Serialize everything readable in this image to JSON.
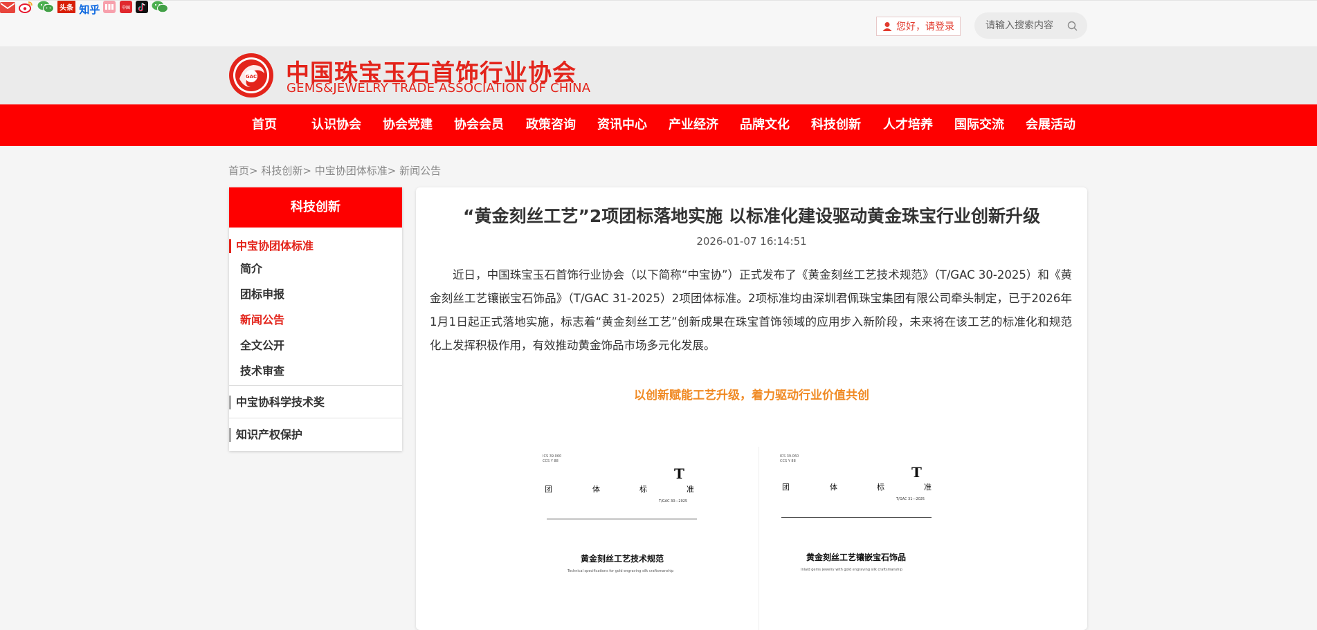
{
  "topbar": {
    "icons": [
      "mail-icon",
      "weibo-icon",
      "wechat-icon",
      "toutiao-icon",
      "zhihu-icon",
      "xiaohongshu-icon",
      "china-icon",
      "douyin-icon",
      "wechat-channel-icon"
    ],
    "toutiao_label": "头条",
    "zhihu_label": "知乎",
    "china_label": "中国",
    "login_text": "您好，请登录",
    "search_placeholder": "请输入搜索内容"
  },
  "header": {
    "title_cn": "中国珠宝玉石首饰行业协会",
    "title_en": "GEMS&JEWELRY TRADE ASSOCIATION OF CHINA",
    "emblem_text": "GAC"
  },
  "nav": {
    "items": [
      "首页",
      "认识协会",
      "协会党建",
      "协会会员",
      "政策咨询",
      "资讯中心",
      "产业经济",
      "品牌文化",
      "科技创新",
      "人才培养",
      "国际交流",
      "会展活动"
    ]
  },
  "breadcrumb": {
    "items": [
      "首页",
      "科技创新",
      "中宝协团体标准",
      "新闻公告"
    ],
    "separator": ">"
  },
  "sidebar": {
    "heading": "科技创新",
    "cat1": "中宝协团体标准",
    "subs": [
      "简介",
      "团标申报",
      "新闻公告",
      "全文公开",
      "技术审查"
    ],
    "cat2": "中宝协科学技术奖",
    "cat3": "知识产权保护"
  },
  "article": {
    "title": "“黄金刻丝工艺”2项团标落地实施 以标准化建设驱动黄金珠宝行业创新升级",
    "date": "2026-01-07 16:14:51",
    "body": "近日，中国珠宝玉石首饰行业协会（以下简称“中宝协”）正式发布了《黄金刻丝工艺技术规范》（T/GAC 30-2025）和《黄金刻丝工艺镶嵌宝石饰品》（T/GAC 31-2025）2项团体标准。2项标准均由深圳君佩珠宝集团有限公司牵头制定，已于2026年1月1日起正式落地实施，标志着“黄金刻丝工艺”创新成果在珠宝首饰领域的应用步入新阶段，未来将在该工艺的标准化和规范化上发挥积极作用，有效推动黄金饰品市场多元化发展。",
    "subhead": "以创新赋能工艺升级，着力驱动行业价值共创",
    "docs": [
      {
        "ics": "ICS 39.060",
        "ccs": "CCS Y 88",
        "letter": "T",
        "std_chars": [
          "团",
          "体",
          "标",
          "准"
        ],
        "code": "T/GAC 30—2025",
        "title": "黄金刻丝工艺技术规范",
        "subtitle": "Technical specifications for gold engraving silk craftsmanship"
      },
      {
        "ics": "ICS 39.060",
        "ccs": "CCS Y 88",
        "letter": "T",
        "std_chars": [
          "团",
          "体",
          "标",
          "准"
        ],
        "code": "T/GAC 31—2025",
        "title": "黄金刻丝工艺镶嵌宝石饰品",
        "subtitle": "Inlaid gems jewelry with gold engraving silk craftsmanship"
      }
    ]
  },
  "colors": {
    "brand_red": "#fe0000",
    "logo_red": "#e3241b",
    "subhead_orange": "#f08a24"
  }
}
